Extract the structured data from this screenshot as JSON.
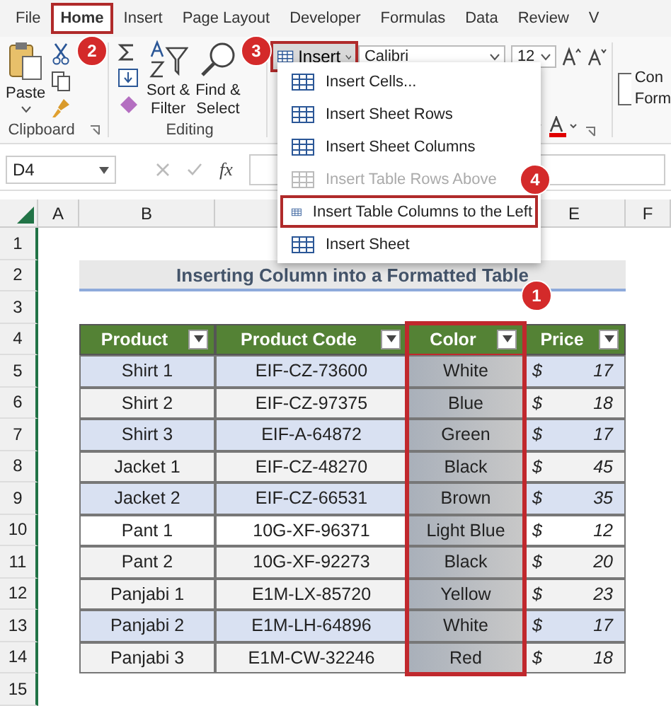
{
  "tabs": [
    {
      "label": "File",
      "selected": false
    },
    {
      "label": "Home",
      "selected": true
    },
    {
      "label": "Insert",
      "selected": false
    },
    {
      "label": "Page Layout",
      "selected": false
    },
    {
      "label": "Developer",
      "selected": false
    },
    {
      "label": "Formulas",
      "selected": false
    },
    {
      "label": "Data",
      "selected": false
    },
    {
      "label": "Review",
      "selected": false
    },
    {
      "label": "V",
      "selected": false
    }
  ],
  "ribbon": {
    "clipboard": {
      "paste": "Paste",
      "label": "Clipboard"
    },
    "editing": {
      "sort": [
        "Sort &",
        "Filter"
      ],
      "find": [
        "Find &",
        "Select"
      ],
      "label": "Editing"
    },
    "cells": {
      "insert": "Insert",
      "boxed": true
    },
    "font": {
      "name": "Calibri",
      "size": "12"
    },
    "cut_off": [
      "Con",
      "Form"
    ]
  },
  "formula_bar": {
    "name_box": "D4",
    "fx": "fx"
  },
  "menu": [
    {
      "label": "Insert Cells...",
      "disabled": false,
      "selected": false
    },
    {
      "label": "Insert Sheet Rows",
      "disabled": false,
      "selected": false
    },
    {
      "label": "Insert Sheet Columns",
      "disabled": false,
      "selected": false
    },
    {
      "label": "Insert Table Rows Above",
      "disabled": true,
      "selected": false
    },
    {
      "label": "Insert Table Columns to the Left",
      "disabled": false,
      "selected": true
    },
    {
      "label": "Insert Sheet",
      "disabled": false,
      "selected": false
    }
  ],
  "badges": [
    "1",
    "2",
    "3",
    "4"
  ],
  "sheet": {
    "columns": [
      "A",
      "B",
      "E",
      "F"
    ],
    "row_numbers": [
      "1",
      "2",
      "3",
      "4",
      "5",
      "6",
      "7",
      "8",
      "9",
      "10",
      "11",
      "12",
      "13",
      "14",
      "15"
    ],
    "title": "Inserting Column into a Formatted Table",
    "table": {
      "columns": [
        {
          "label": "Product",
          "highlighted": false
        },
        {
          "label": "Product Code",
          "highlighted": false
        },
        {
          "label": "Color",
          "highlighted": true
        },
        {
          "label": "Price",
          "highlighted": false
        }
      ],
      "rows": [
        {
          "color": "#d9e1f2",
          "cells": [
            "Shirt 1",
            "EIF-CZ-73600",
            "White"
          ],
          "price": {
            "currency": "$",
            "amount": "17"
          }
        },
        {
          "color": "#f2f2f2",
          "cells": [
            "Shirt 2",
            "EIF-CZ-97375",
            "Blue"
          ],
          "price": {
            "currency": "$",
            "amount": "18"
          }
        },
        {
          "color": "#d9e1f2",
          "cells": [
            "Shirt 3",
            "EIF-A-64872",
            "Green"
          ],
          "price": {
            "currency": "$",
            "amount": "17"
          }
        },
        {
          "color": "#f2f2f2",
          "cells": [
            "Jacket 1",
            "EIF-CZ-48270",
            "Black"
          ],
          "price": {
            "currency": "$",
            "amount": "45"
          }
        },
        {
          "color": "#d9e1f2",
          "cells": [
            "Jacket 2",
            "EIF-CZ-66531",
            "Brown"
          ],
          "price": {
            "currency": "$",
            "amount": "35"
          }
        },
        {
          "color": "#ffffff",
          "cells": [
            "Pant 1",
            "10G-XF-96371",
            "Light Blue"
          ],
          "price": {
            "currency": "$",
            "amount": "12"
          }
        },
        {
          "color": "#f2f2f2",
          "cells": [
            "Pant 2",
            "10G-XF-92273",
            "Black"
          ],
          "price": {
            "currency": "$",
            "amount": "20"
          }
        },
        {
          "color": "#f2f2f2",
          "cells": [
            "Panjabi 1",
            "E1M-LX-85720",
            "Yellow"
          ],
          "price": {
            "currency": "$",
            "amount": "23"
          }
        },
        {
          "color": "#d9e1f2",
          "cells": [
            "Panjabi 2",
            "E1M-LH-64896",
            "White"
          ],
          "price": {
            "currency": "$",
            "amount": "17"
          }
        },
        {
          "color": "#f2f2f2",
          "cells": [
            "Panjabi 3",
            "E1M-CW-32246",
            "Red"
          ],
          "price": {
            "currency": "$",
            "amount": "18"
          }
        }
      ]
    }
  }
}
